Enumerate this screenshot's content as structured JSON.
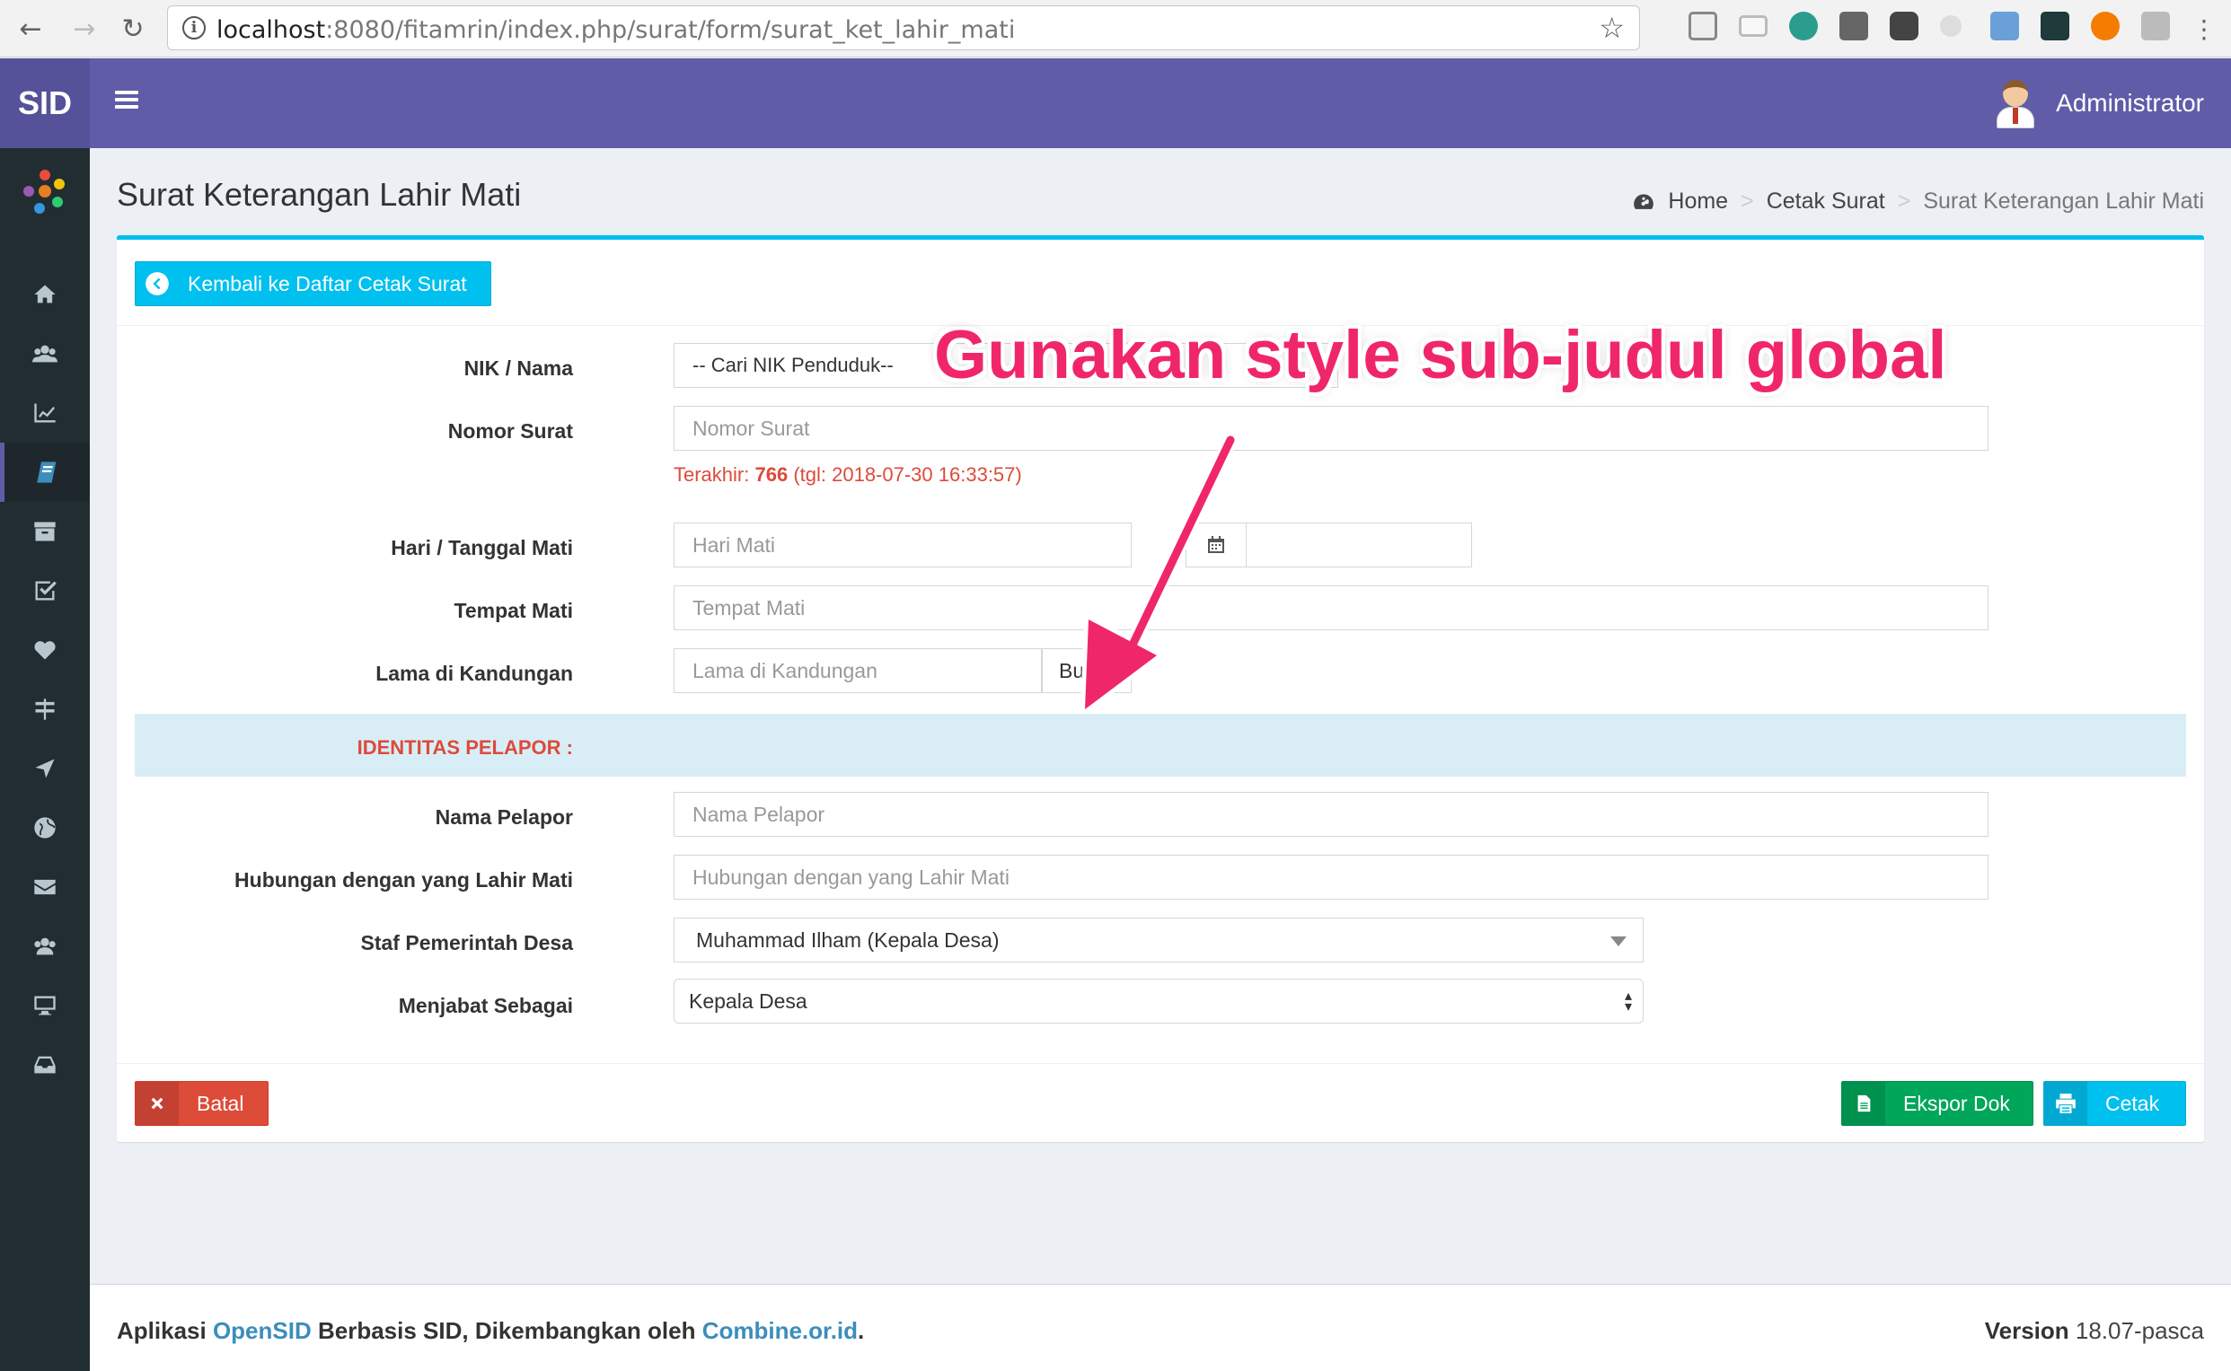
{
  "browser": {
    "url_host": "localhost",
    "url_rest": ":8080/fitamrin/index.php/surat/form/surat_ket_lahir_mati"
  },
  "header": {
    "logo": "SID",
    "user_name": "Administrator"
  },
  "sidebar": {
    "items": [
      {
        "icon": "home-icon"
      },
      {
        "icon": "users-icon"
      },
      {
        "icon": "chart-icon"
      },
      {
        "icon": "book-icon",
        "active": true
      },
      {
        "icon": "archive-icon"
      },
      {
        "icon": "checkbox-icon"
      },
      {
        "icon": "heart-icon"
      },
      {
        "icon": "signpost-icon"
      },
      {
        "icon": "location-arrow-icon"
      },
      {
        "icon": "globe-icon"
      },
      {
        "icon": "envelope-icon"
      },
      {
        "icon": "users-icon"
      },
      {
        "icon": "desktop-icon"
      },
      {
        "icon": "inbox-icon"
      }
    ]
  },
  "page": {
    "title": "Surat Keterangan Lahir Mati",
    "breadcrumb": [
      "Home",
      "Cetak Surat",
      "Surat Keterangan Lahir Mati"
    ]
  },
  "form": {
    "back_button": "Kembali ke Daftar Cetak Surat",
    "nik_label": "NIK / Nama",
    "nik_placeholder": "-- Cari NIK Penduduk--",
    "nomor_label": "Nomor Surat",
    "nomor_placeholder": "Nomor Surat",
    "last_prefix": "Terakhir:",
    "last_number": "766",
    "last_date": "(tgl: 2018-07-30 16:33:57)",
    "hari_label": "Hari / Tanggal Mati",
    "hari_placeholder": "Hari Mati",
    "tanggal_value": "",
    "tempat_label": "Tempat Mati",
    "tempat_placeholder": "Tempat Mati",
    "lama_label": "Lama di Kandungan",
    "lama_placeholder": "Lama di Kandungan",
    "lama_unit": "Bulan",
    "section_pelapor": "IDENTITAS PELAPOR :",
    "nama_pelapor_label": "Nama Pelapor",
    "nama_pelapor_placeholder": "Nama Pelapor",
    "hubungan_label": "Hubungan dengan yang Lahir Mati",
    "hubungan_placeholder": "Hubungan dengan yang Lahir Mati",
    "staf_label": "Staf Pemerintah Desa",
    "staf_value": "Muhammad Ilham (Kepala Desa)",
    "jabatan_label": "Menjabat Sebagai",
    "jabatan_value": "Kepala Desa"
  },
  "actions": {
    "cancel": "Batal",
    "export": "Ekspor Dok",
    "print": "Cetak"
  },
  "annotation": {
    "text": "Gunakan style sub-judul global",
    "color": "#f0266b"
  },
  "footer": {
    "prefix": "Aplikasi",
    "app_link": "OpenSID",
    "middle": "Berbasis SID, Dikembangkan oleh",
    "dev_link": "Combine.or.id",
    "end": ".",
    "version_label": "Version",
    "version_value": "18.07-pasca"
  },
  "colors": {
    "header": "#605ca8",
    "sidebar": "#222d32",
    "info": "#00c0ef",
    "danger": "#dd4b39",
    "success": "#00a65a"
  }
}
